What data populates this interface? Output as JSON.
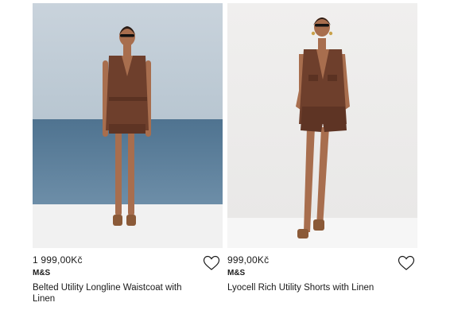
{
  "products": [
    {
      "price": "1 999,00Kč",
      "brand": "M&S",
      "title": "Belted Utility Longline Waistcoat with Linen",
      "wishlist_icon": "heart-outline-icon"
    },
    {
      "price": "999,00Kč",
      "brand": "M&S",
      "title": "Lyocell Rich Utility Shorts with Linen",
      "wishlist_icon": "heart-outline-icon"
    }
  ],
  "colors": {
    "outfit_brown": "#6e3f2c",
    "skin": "#a86e4e",
    "sea": "#5a7a93",
    "sky": "#b9c8d4",
    "studio_bg": "#eeedec"
  }
}
